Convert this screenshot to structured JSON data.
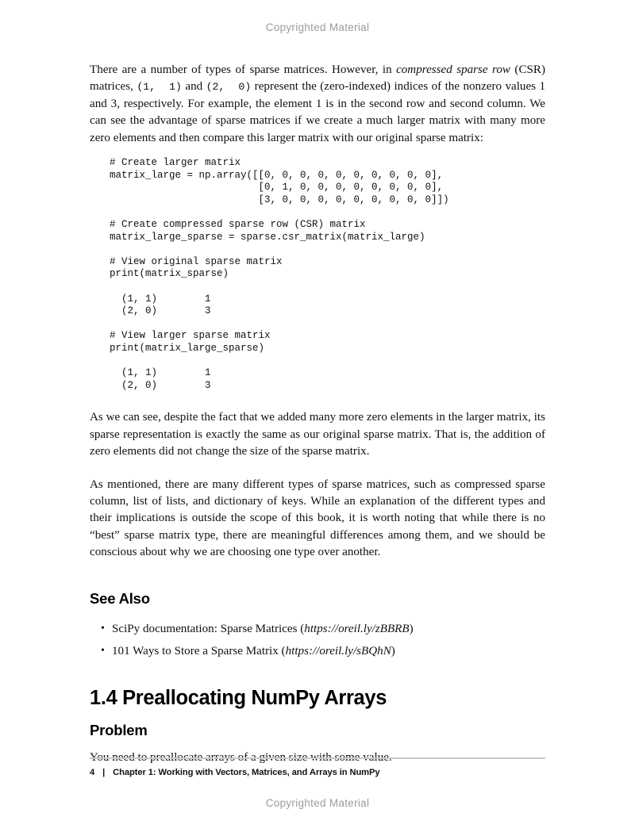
{
  "watermark": {
    "top": "Copyrighted Material",
    "bottom": "Copyrighted Material"
  },
  "body": {
    "paragraph_1_part_1": "There are a number of types of sparse matrices. However, in ",
    "paragraph_1_italic": "compressed sparse row",
    "paragraph_1_part_2": " (CSR) matrices, ",
    "paragraph_1_code_1": "(1,  1)",
    "paragraph_1_part_3": " and ",
    "paragraph_1_code_2": "(2,  0)",
    "paragraph_1_part_4": " represent the (zero-indexed) indices of the nonzero values 1 and 3, respectively. For example, the element 1 is in the second row and second column. We can see the advantage of sparse matrices if we create a much larger matrix with many more zero elements and then compare this larger matrix with our original sparse matrix:",
    "paragraph_2": "As we can see, despite the fact that we added many more zero elements in the larger matrix, its sparse representation is exactly the same as our original sparse matrix. That is, the addition of zero elements did not change the size of the sparse matrix.",
    "paragraph_3": "As mentioned, there are many different types of sparse matrices, such as compressed sparse column, list of lists, and dictionary of keys. While an explanation of the different types and their implications is outside the scope of this book, it is worth noting that while there is no “best” sparse matrix type, there are meaningful differences among them, and we should be conscious about why we are choosing one type over another.",
    "problem_text": "You need to preallocate arrays of a given size with some value."
  },
  "code": {
    "block_1": "# Create larger matrix\nmatrix_large = np.array([[0, 0, 0, 0, 0, 0, 0, 0, 0, 0],\n                         [0, 1, 0, 0, 0, 0, 0, 0, 0, 0],\n                         [3, 0, 0, 0, 0, 0, 0, 0, 0, 0]])",
    "block_2": "# Create compressed sparse row (CSR) matrix\nmatrix_large_sparse = sparse.csr_matrix(matrix_large)",
    "block_3": "# View original sparse matrix\nprint(matrix_sparse)",
    "output_1": "  (1, 1)\t1\n  (2, 0)\t3",
    "block_4": "# View larger sparse matrix\nprint(matrix_large_sparse)",
    "output_2": "  (1, 1)\t1\n  (2, 0)\t3"
  },
  "headings": {
    "see_also": "See Also",
    "recipe": "1.4 Preallocating NumPy Arrays",
    "problem": "Problem"
  },
  "see_also_items": [
    {
      "bullet": "•",
      "text": "SciPy documentation: Sparse Matrices (",
      "url": "https://oreil.ly/zBBRB",
      "close": ")"
    },
    {
      "bullet": "•",
      "text": "101 Ways to Store a Sparse Matrix (",
      "url": "https://oreil.ly/sBQhN",
      "close": ")"
    }
  ],
  "footer": {
    "page_number": "4",
    "separator": "|",
    "chapter": "Chapter 1: Working with Vectors, Matrices, and Arrays in NumPy"
  }
}
